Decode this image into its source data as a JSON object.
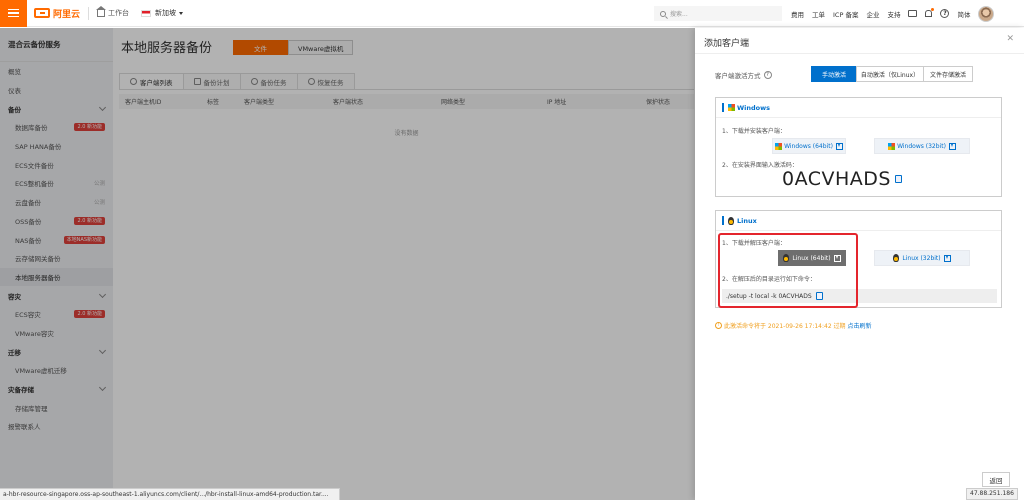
{
  "topbar": {
    "logo": "阿里云",
    "workbench": "工作台",
    "region": "新加坡",
    "search_placeholder": "搜索...",
    "links": [
      "费用",
      "工单",
      "ICP 备案",
      "企业",
      "支持"
    ],
    "lang": "简体",
    "accent": "#ff6a00"
  },
  "sidebar": {
    "title": "混合云备份服务",
    "items": [
      {
        "label": "概览",
        "kind": "item",
        "badge": "",
        "tag": ""
      },
      {
        "label": "仪表",
        "kind": "item",
        "badge": "",
        "tag": ""
      },
      {
        "label": "备份",
        "kind": "group",
        "badge": "",
        "tag": ""
      },
      {
        "label": "数据库备份",
        "kind": "sub",
        "badge": "2.0 新功能",
        "tag": ""
      },
      {
        "label": "SAP HANA备份",
        "kind": "sub",
        "badge": "",
        "tag": ""
      },
      {
        "label": "ECS文件备份",
        "kind": "sub",
        "badge": "",
        "tag": ""
      },
      {
        "label": "ECS整机备份",
        "kind": "sub",
        "badge": "",
        "tag": "公测"
      },
      {
        "label": "云盘备份",
        "kind": "sub",
        "badge": "",
        "tag": "公测"
      },
      {
        "label": "OSS备份",
        "kind": "sub",
        "badge": "2.0 新功能",
        "tag": ""
      },
      {
        "label": "NAS备份",
        "kind": "sub",
        "badge": "本地NAS新功能",
        "tag": ""
      },
      {
        "label": "云存储网关备份",
        "kind": "sub",
        "badge": "",
        "tag": ""
      },
      {
        "label": "本地服务器备份",
        "kind": "sub-active",
        "badge": "",
        "tag": ""
      },
      {
        "label": "容灾",
        "kind": "group",
        "badge": "",
        "tag": ""
      },
      {
        "label": "ECS容灾",
        "kind": "sub",
        "badge": "2.0 新功能",
        "tag": ""
      },
      {
        "label": "VMware容灾",
        "kind": "sub",
        "badge": "",
        "tag": ""
      },
      {
        "label": "迁移",
        "kind": "group",
        "badge": "",
        "tag": ""
      },
      {
        "label": "VMware虚机迁移",
        "kind": "sub",
        "badge": "",
        "tag": ""
      },
      {
        "label": "灾备存储",
        "kind": "group",
        "badge": "",
        "tag": ""
      },
      {
        "label": "存储库管理",
        "kind": "sub",
        "badge": "",
        "tag": ""
      },
      {
        "label": "报警联系人",
        "kind": "item",
        "badge": "",
        "tag": ""
      }
    ]
  },
  "main": {
    "title": "本地服务器备份",
    "seg": [
      "文件",
      "VMware虚拟机"
    ],
    "tabs": [
      "客户端列表",
      "备份计划",
      "备份任务",
      "恢复任务"
    ],
    "columns": [
      "客户端主机ID",
      "标签",
      "客户端类型",
      "客户端状态",
      "网络类型",
      "IP 地址",
      "保护状态"
    ],
    "empty": "没有数据"
  },
  "status_url": "a-hbr-resource-singapore.oss-ap-southeast-1.aliyuncs.com/client/.../hbr-install-linux-amd64-production.tar....",
  "ip": "47.88.251.186",
  "drawer": {
    "title": "添加客户端",
    "activation_label": "客户端激活方式",
    "activation_options": [
      "手动激活",
      "自动激活（仅Linux）",
      "文件存储激活"
    ],
    "windows": {
      "title": "Windows",
      "step1": "1、下载并安装客户端：",
      "btn64": "Windows (64bit)",
      "btn32": "Windows (32bit)",
      "step2": "2、在安装界面输入激活码：",
      "code": "0ACVHADS"
    },
    "linux": {
      "title": "Linux",
      "step1": "1、下载并解压客户端：",
      "btn64": "Linux (64bit)",
      "btn32": "Linux (32bit)",
      "step2": "2、在解压后的目录运行如下命令：",
      "command": "./setup -t local -k 0ACVHADS"
    },
    "expire_text": "此激活命令将于 2021-09-26 17:14:42 过期",
    "refresh_link": "点击刷新",
    "back": "返回",
    "primary_color": "#0070cc",
    "highlight_color": "#e4252d"
  }
}
